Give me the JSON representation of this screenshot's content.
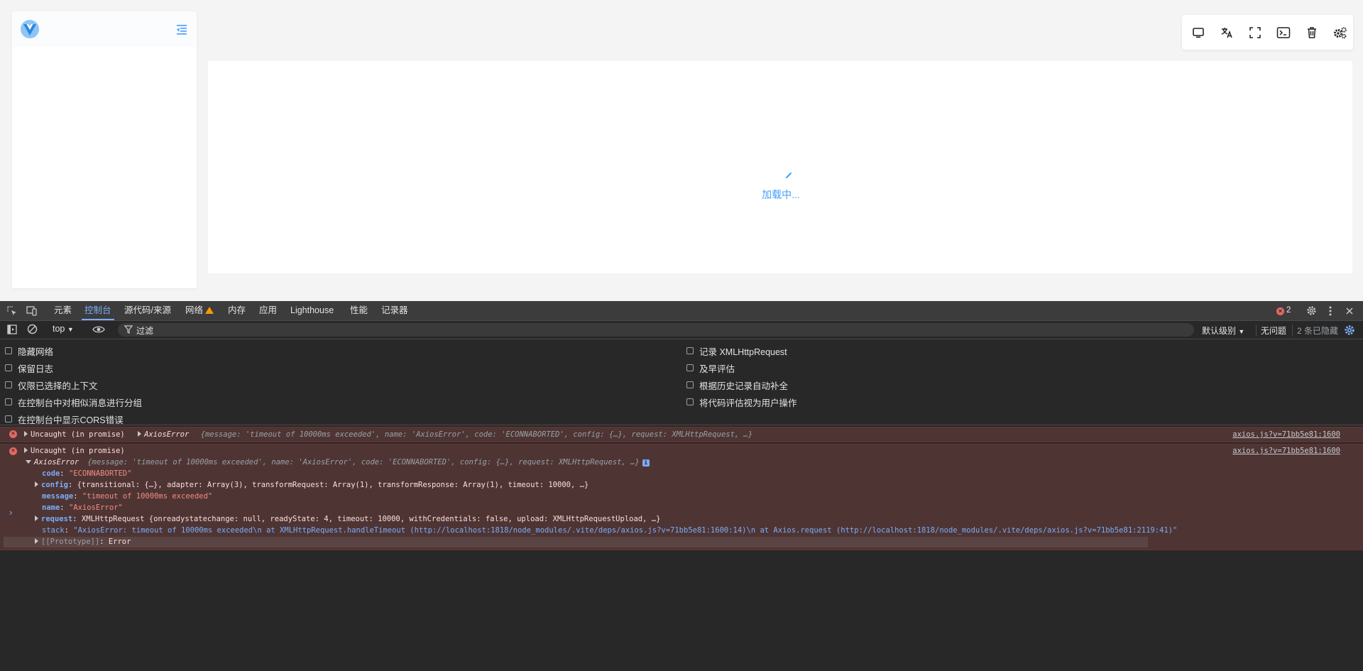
{
  "app": {
    "loading_text": "加载中...",
    "toolbar_icons": [
      "monitor-icon",
      "translate-icon",
      "fullscreen-icon",
      "terminal-icon",
      "trash-icon",
      "settings-gear-icon"
    ],
    "accent": "#409eff"
  },
  "devtools": {
    "tabs": [
      {
        "label": "元素"
      },
      {
        "label": "控制台"
      },
      {
        "label": "源代码/来源"
      },
      {
        "label": "网络"
      },
      {
        "label": "内存"
      },
      {
        "label": "应用"
      },
      {
        "label": "Lighthouse"
      },
      {
        "label": "性能"
      },
      {
        "label": "记录器"
      }
    ],
    "active_tab": "控制台",
    "error_count": "2",
    "context": "top",
    "filter_placeholder": "过滤",
    "log_level": "默认级别",
    "issues": "无问题",
    "hidden_count": "2 条已隐藏",
    "settings_left": [
      "隐藏网络",
      "保留日志",
      "仅限已选择的上下文",
      "在控制台中对相似消息进行分组",
      "在控制台中显示CORS错误"
    ],
    "settings_right": [
      "记录 XMLHttpRequest",
      "及早评估",
      "根据历史记录自动补全",
      "将代码评估视为用户操作"
    ],
    "messages": [
      {
        "prefix": "Uncaught (in promise)",
        "class_name": "AxiosError",
        "summary": "{message: 'timeout of 10000ms exceeded', name: 'AxiosError', code: 'ECONNABORTED', config: {…}, request: XMLHttpRequest, …}",
        "source": "axios.js?v=71bb5e81:1600"
      },
      {
        "prefix": "Uncaught (in promise)",
        "source": "axios.js?v=71bb5e81:1600",
        "expanded_header_class": "AxiosError",
        "expanded_header_summary": "{message: 'timeout of 10000ms exceeded', name: 'AxiosError', code: 'ECONNABORTED', config: {…}, request: XMLHttpRequest, …}",
        "props": {
          "code_key": "code",
          "code_val": "\"ECONNABORTED\"",
          "config_key": "config",
          "config_val": "{transitional: {…}, adapter: Array(3), transformRequest: Array(1), transformResponse: Array(1), timeout: 10000, …}",
          "message_key": "message",
          "message_val": "\"timeout of 10000ms exceeded\"",
          "name_key": "name",
          "name_val": "\"AxiosError\"",
          "request_key": "request",
          "request_val": "XMLHttpRequest  {onreadystatechange: null, readyState: 4, timeout: 10000, withCredentials: false, upload: XMLHttpRequestUpload, …}",
          "stack_key": "stack",
          "stack_val": "\"AxiosError: timeout of 10000ms exceeded\\n    at XMLHttpRequest.handleTimeout (http://localhost:1818/node_modules/.vite/deps/axios.js?v=71bb5e81:1600:14)\\n    at Axios.request (http://localhost:1818/node_modules/.vite/deps/axios.js?v=71bb5e81:2119:41)\"",
          "proto_key": "[[Prototype]]",
          "proto_val": "Error"
        }
      }
    ],
    "prompt": "›"
  }
}
